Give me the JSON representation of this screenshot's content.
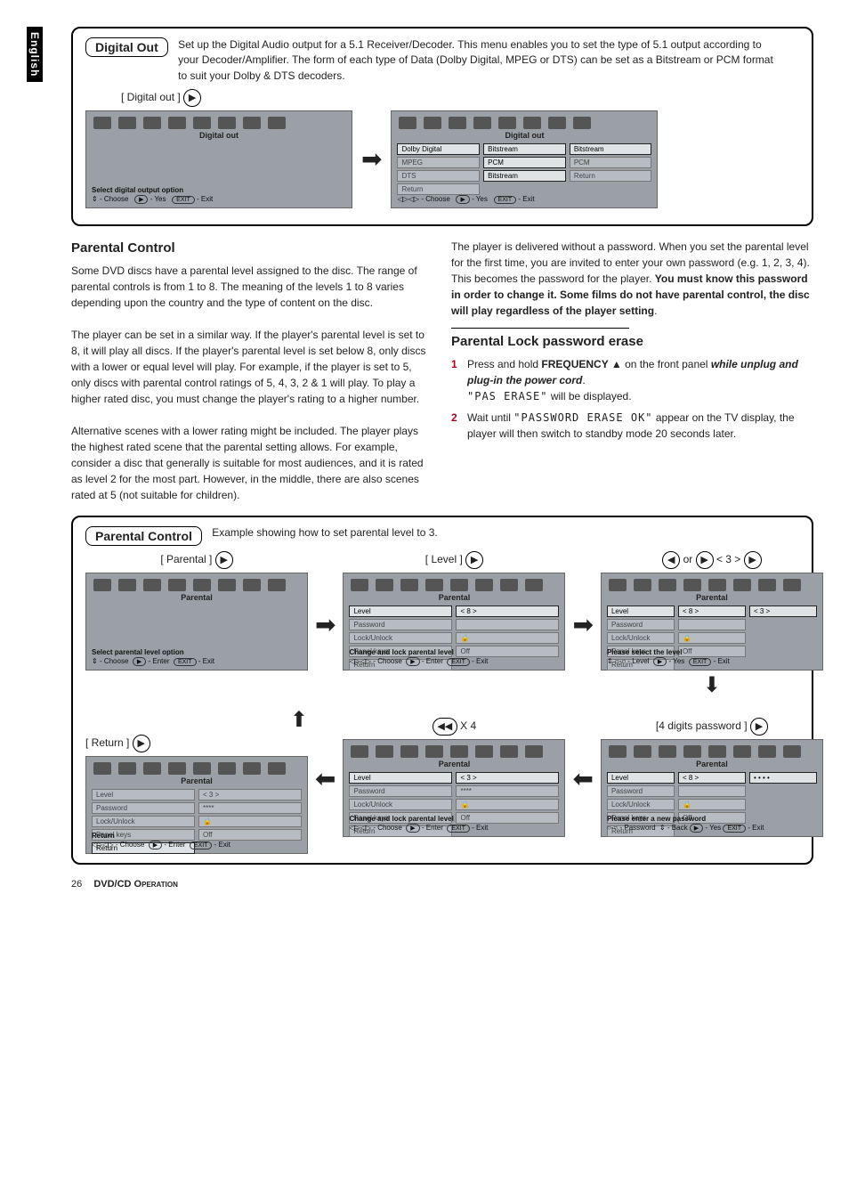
{
  "sideTab": "English",
  "digitalOut": {
    "title": "Digital Out",
    "intro": "Set up the Digital Audio output for a 5.1 Receiver/Decoder.  This menu enables you to set the type of 5.1 output according to your Decoder/Amplifier.  The form of each type of Data (Dolby Digital, MPEG or DTS) can be set as a Bitstream or PCM format to suit your Dolby & DTS decoders.",
    "crumb": "[ Digital out ]",
    "osdTitle": "Digital out",
    "left": {
      "foot1": "Select digital output option",
      "footChoose": "- Choose",
      "footYes": "- Yes",
      "footExit": "- Exit"
    },
    "right": {
      "rows": [
        {
          "a": "Dolby Digital",
          "b": "Bitstream",
          "c": "Bitstream",
          "activeA": true
        },
        {
          "a": "MPEG",
          "b": "PCM",
          "c": "PCM"
        },
        {
          "a": "DTS",
          "b": "Bitstream",
          "c": "Return"
        },
        {
          "a": "Return",
          "b": "",
          "c": ""
        }
      ],
      "footChoose": "- Choose",
      "footYes": "- Yes",
      "footExit": "- Exit"
    }
  },
  "parental": {
    "heading": "Parental Control",
    "p1": "Some DVD discs have a parental level assigned to the disc.  The range of parental controls is from 1 to 8.  The meaning of the levels 1 to 8 varies depending upon the country and the type of content on the disc.",
    "p2": "The player can be set in a similar way.  If the player's parental level is set to 8, it will play all discs.  If the player's parental level is set below 8, only discs with a lower or equal level will play.  For example, if the player is set to 5, only discs with parental control ratings of 5, 4, 3, 2 & 1 will play.  To play a higher rated disc, you must change the player's rating to a higher number.",
    "p3": "Alternative scenes with a lower rating might be included.  The player plays the highest rated scene that the parental setting allows.  For example, consider a disc that generally is suitable for most audiences, and it is rated as level 2 for the most part.  However, in the middle, there are also scenes rated at 5 (not suitable for children).",
    "r1a": "The player is delivered without a password.  When you set the parental level for the first time, you are invited to enter your own password (e.g. 1, 2, 3, 4).  This becomes the password for the player.  ",
    "r1b": "You must know this password in order to change it.  Some films do not have parental control, the disc will play regardless of the player setting",
    "r1c": ".",
    "eraseHeading": "Parental Lock password erase",
    "step1a": "Press and hold ",
    "step1b": "FREQUENCY ▲",
    "step1c": " on the front panel ",
    "step1d": "while unplug and plug-in the power cord",
    "step1e": ".",
    "step1disp": "\"PAS ERASE\"",
    "step1f": " will be displayed.",
    "step2a": "Wait until ",
    "step2disp": "\"PASSWORD ERASE OK\"",
    "step2b": " appear on the TV display, the player will then switch to standby mode 20 seconds later."
  },
  "parentalBox": {
    "title": "Parental Control",
    "caption": "Example showing how to set parental level to 3.",
    "osdTitle": "Parental",
    "labels": {
      "level": "Level",
      "password": "Password",
      "lock": "Lock/Unlock",
      "panel": "Panel keys",
      "ret": "Return",
      "off": "Off",
      "l8": "< 8 >",
      "l3": "< 3 >",
      "stars": "****",
      "dots": "• • • •"
    },
    "crumbs": {
      "parental": "[ Parental ]",
      "level": "[ Level ]",
      "arrows": "< 3 >",
      "orText": "or",
      "pw": "[4 digits password ]",
      "x4": "X 4",
      "ret": "[ Return ]"
    },
    "foots": {
      "selOpt": "Select parental level option",
      "chgLock": "Change and lock parental level",
      "selLvl": "Please select the level",
      "newPw": "Please enter a new password",
      "ret": "Return",
      "choose": "- Choose",
      "enter": "- Enter",
      "exit": "- Exit",
      "levelBtn": "- Level",
      "yes": "- Yes",
      "pwBtn": "- Password",
      "back": "- Back"
    }
  },
  "footer": {
    "page": "26",
    "section": "DVD/CD ",
    "sectionCaps": "Operation"
  }
}
